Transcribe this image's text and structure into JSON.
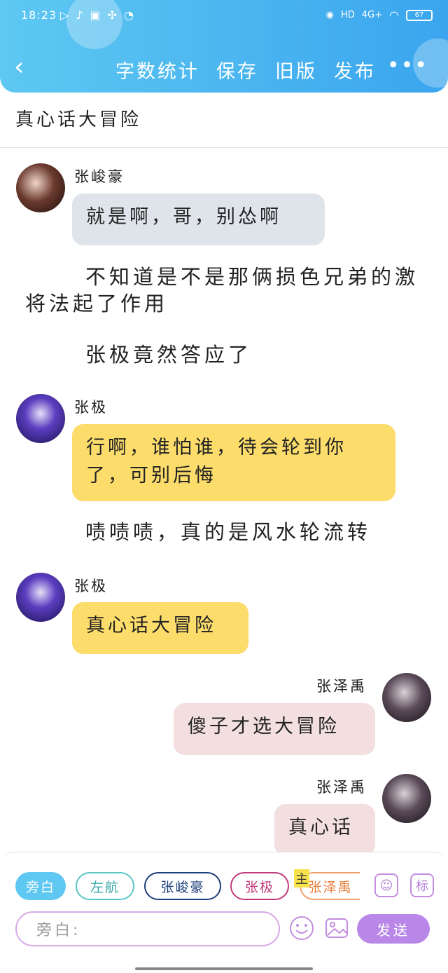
{
  "status_bar": {
    "time": "18:23",
    "network": "4G+",
    "hd": "HD",
    "battery": "67"
  },
  "nav": {
    "actions": [
      "字数统计",
      "保存",
      "旧版",
      "发布"
    ],
    "more": "•••"
  },
  "document": {
    "title": "真心话大冒险"
  },
  "messages": [
    {
      "type": "chat",
      "name": "张峻豪",
      "text": "就是啊，哥，别怂啊"
    },
    {
      "type": "narration",
      "text": "不知道是不是那俩损色兄弟的激将法起了作用"
    },
    {
      "type": "narration",
      "text": "张极竟然答应了"
    },
    {
      "type": "chat",
      "name": "张极",
      "text": "行啊，谁怕谁，待会轮到你了，可别后悔"
    },
    {
      "type": "narration",
      "text": "啧啧啧，真的是风水轮流转"
    },
    {
      "type": "chat",
      "name": "张极",
      "text": "真心话大冒险"
    },
    {
      "type": "chat",
      "name": "张泽禹",
      "text": "傻子才选大冒险"
    },
    {
      "type": "chat",
      "name": "张泽禹",
      "text": "真心话"
    }
  ],
  "composer": {
    "role_chips": [
      "旁白",
      "左航",
      "张峻豪",
      "张极",
      "张泽禹"
    ],
    "main_tag": "主",
    "label_icon": "标",
    "input_placeholder": "旁白:",
    "send_label": "发送"
  },
  "colors": {
    "header": "#4ab7f0",
    "bubble_grey": "#dfe3ea",
    "bubble_yellow": "#fcdc6b",
    "bubble_pink": "#f3dfe0",
    "accent_purple": "#b987e8"
  }
}
